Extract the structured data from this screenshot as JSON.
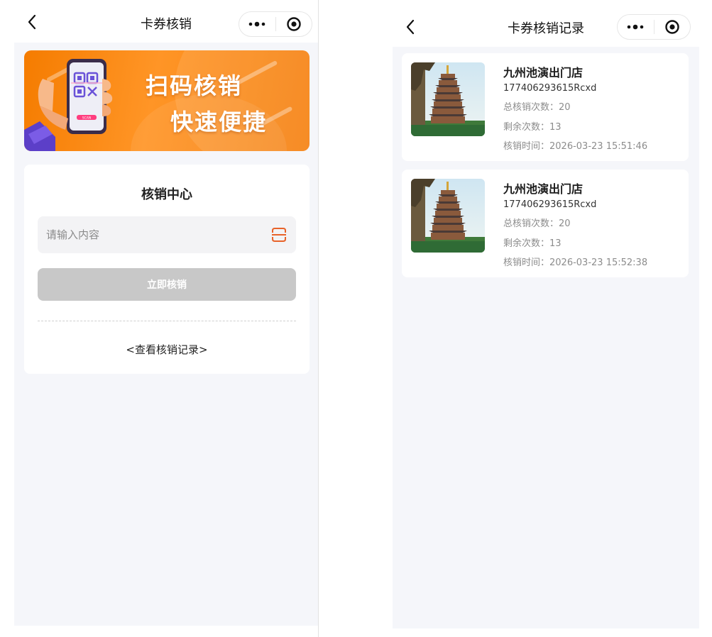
{
  "left_screen": {
    "nav": {
      "title": "卡券核销"
    },
    "banner": {
      "line1": "扫码核销",
      "line2": "快速便捷",
      "scan_tag": "SCAN"
    },
    "card": {
      "title": "核销中心",
      "input_placeholder": "请输入内容",
      "input_value": "",
      "submit_label": "立即核销",
      "record_link": "<查看核销记录>"
    }
  },
  "right_screen": {
    "nav": {
      "title": "卡券核销记录"
    },
    "records": [
      {
        "shop": "九州池演出门店",
        "code": "177406293615Rcxd",
        "total_label": "总核销次数：",
        "total": "20",
        "remain_label": "剩余次数：",
        "remain": "13",
        "time_label": "核销时间：",
        "time": "2026-03-23 15:51:46"
      },
      {
        "shop": "九州池演出门店",
        "code": "177406293615Rcxd",
        "total_label": "总核销次数：",
        "total": "20",
        "remain_label": "剩余次数：",
        "remain": "13",
        "time_label": "核销时间：",
        "time": "2026-03-23 15:52:38"
      }
    ]
  },
  "icons": [
    "back-arrow-icon",
    "more-dots-icon",
    "close-target-icon",
    "scan-icon"
  ],
  "colors": {
    "accent_orange": "#f57c00",
    "scan_icon": "#e8632a",
    "disabled_button": "#c8c8c8",
    "page_bg": "#f5f6fa"
  }
}
